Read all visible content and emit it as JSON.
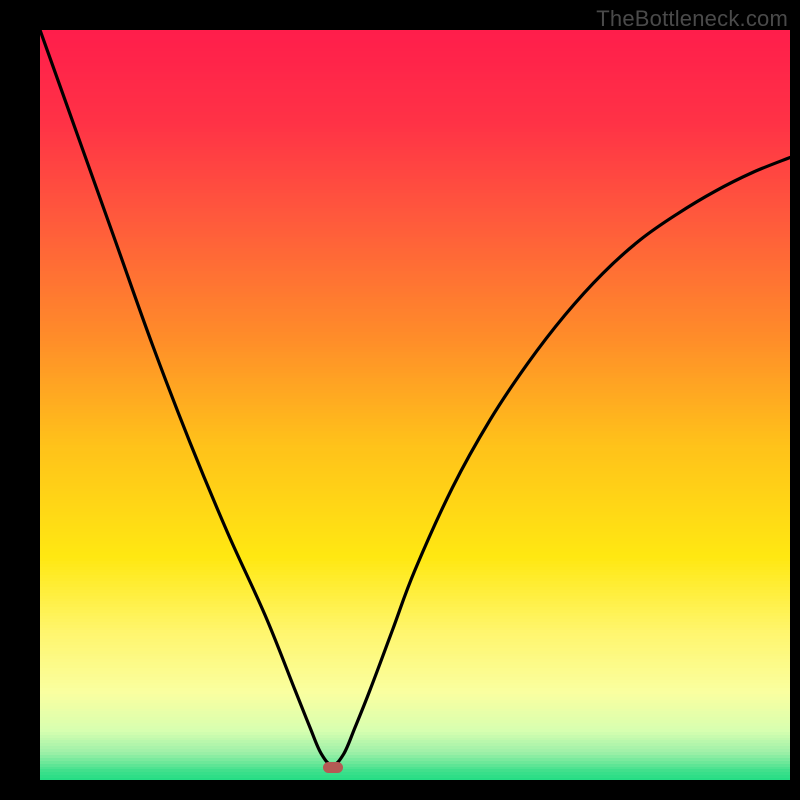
{
  "watermark": "TheBottleneck.com",
  "colors": {
    "black": "#000000",
    "curve": "#000000",
    "marker": "#b45a54"
  },
  "chart_data": {
    "type": "line",
    "title": "",
    "xlabel": "",
    "ylabel": "",
    "xlim": [
      0,
      100
    ],
    "ylim": [
      0,
      100
    ],
    "grid": false,
    "legend": false,
    "annotations": [
      "TheBottleneck.com"
    ],
    "gradient_stops": [
      {
        "pos": 0.0,
        "color": "#ff1e4b"
      },
      {
        "pos": 0.12,
        "color": "#ff3246"
      },
      {
        "pos": 0.25,
        "color": "#ff5a3c"
      },
      {
        "pos": 0.4,
        "color": "#ff8a2a"
      },
      {
        "pos": 0.55,
        "color": "#ffc21a"
      },
      {
        "pos": 0.7,
        "color": "#ffe812"
      },
      {
        "pos": 0.8,
        "color": "#fff66e"
      },
      {
        "pos": 0.88,
        "color": "#faffa0"
      },
      {
        "pos": 0.93,
        "color": "#d8ffb0"
      },
      {
        "pos": 0.96,
        "color": "#9ef0a8"
      },
      {
        "pos": 0.985,
        "color": "#3fe08c"
      },
      {
        "pos": 1.0,
        "color": "#1edc82"
      }
    ],
    "marker": {
      "x": 39,
      "y": 1.7
    },
    "series": [
      {
        "name": "curve",
        "x": [
          0,
          5,
          10,
          15,
          20,
          25,
          30,
          34,
          36,
          37.5,
          39,
          40.5,
          42,
          44,
          47,
          50,
          55,
          60,
          65,
          70,
          75,
          80,
          85,
          90,
          95,
          100
        ],
        "values": [
          100,
          86,
          72,
          58,
          45,
          33,
          22,
          12,
          7,
          3.5,
          2,
          3.5,
          7,
          12,
          20,
          28,
          39,
          48,
          55.5,
          62,
          67.5,
          72,
          75.5,
          78.5,
          81,
          83
        ]
      }
    ]
  }
}
